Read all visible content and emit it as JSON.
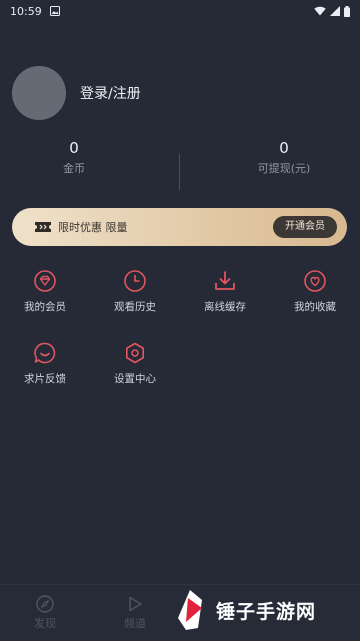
{
  "status": {
    "time": "10:59"
  },
  "profile": {
    "login_label": "登录/注册"
  },
  "stats": {
    "coins_value": "0",
    "coins_label": "金币",
    "cash_value": "0",
    "cash_label": "可提现(元)"
  },
  "vip": {
    "text": "限时优惠 限量",
    "button": "开通会员"
  },
  "menu": [
    {
      "label": "我的会员",
      "icon": "diamond-icon"
    },
    {
      "label": "观看历史",
      "icon": "clock-icon"
    },
    {
      "label": "离线缓存",
      "icon": "download-icon"
    },
    {
      "label": "我的收藏",
      "icon": "heart-icon"
    },
    {
      "label": "求片反馈",
      "icon": "chat-icon"
    },
    {
      "label": "设置中心",
      "icon": "settings-icon"
    }
  ],
  "nav": [
    {
      "label": "发现",
      "icon": "compass-icon"
    },
    {
      "label": "频道",
      "icon": "play-icon"
    }
  ],
  "watermark": {
    "text": "锤子手游网"
  },
  "colors": {
    "accent": "#e2565f",
    "vip_gold": "#d8b98f",
    "background": "#252a36"
  }
}
